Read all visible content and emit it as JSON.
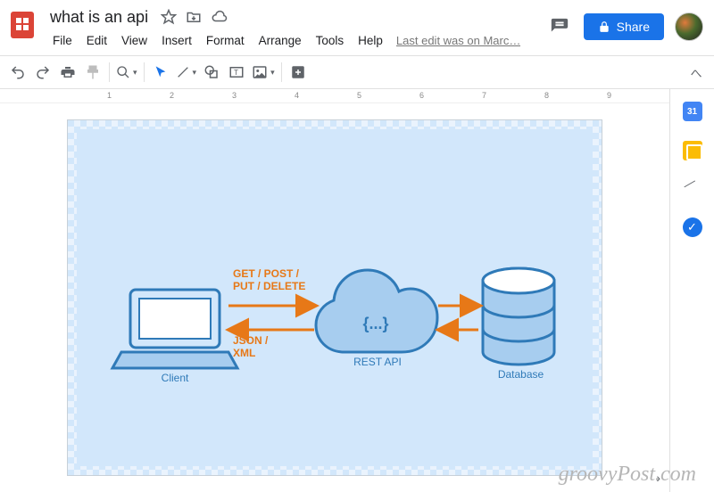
{
  "doc": {
    "title": "what is an api"
  },
  "menu": {
    "file": "File",
    "edit": "Edit",
    "view": "View",
    "insert": "Insert",
    "format": "Format",
    "arrange": "Arrange",
    "tools": "Tools",
    "help": "Help",
    "last_edit": "Last edit was on Marc…"
  },
  "header": {
    "share": "Share",
    "calendar_day": "31"
  },
  "ruler": {
    "m1": "1",
    "m2": "2",
    "m3": "3",
    "m4": "4",
    "m5": "5",
    "m6": "6",
    "m7": "7",
    "m8": "8",
    "m9": "9"
  },
  "diagram": {
    "client_label": "Client",
    "api_label": "REST API",
    "db_label": "Database",
    "request_methods_l1": "GET / POST /",
    "request_methods_l2": "PUT / DELETE",
    "response_format_l1": "JSON /",
    "response_format_l2": "XML",
    "api_glyph": "{...}"
  },
  "watermark": "groovyPost.com"
}
